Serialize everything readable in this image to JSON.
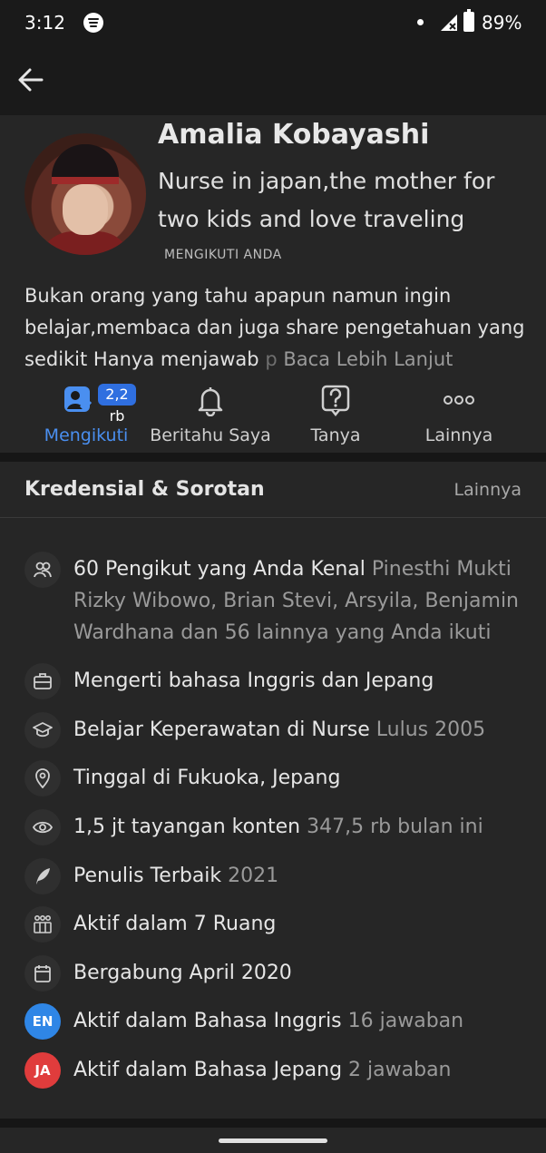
{
  "status_bar": {
    "time": "3:12",
    "battery": "89%"
  },
  "profile": {
    "name": "Amalia Kobayashi",
    "tagline": "Nurse in japan,the mother for two kids and love traveling",
    "follows_you": "MENGIKUTI ANDA",
    "bio_main": "Bukan orang yang tahu apapun namun ingin belajar,membaca dan juga share pengetahuan yang sedikit Hanya menjawab",
    "bio_fade": " p",
    "bio_more": "Baca Lebih Lanjut"
  },
  "actions": {
    "following": {
      "label": "Mengikuti",
      "badge": "2,2 rb"
    },
    "notify": {
      "label": "Beritahu Saya"
    },
    "ask": {
      "label": "Tanya"
    },
    "more": {
      "label": "Lainnya"
    }
  },
  "credentials": {
    "title": "Kredensial & Sorotan",
    "more": "Lainnya",
    "items": [
      {
        "icon": "people-icon",
        "text": "60 Pengikut yang Anda Kenal",
        "sub": "Pinesthi Mukti Rizky Wibowo, Brian Stevi, Arsyila, Benjamin Wardhana dan 56 lainnya yang Anda ikuti"
      },
      {
        "icon": "briefcase-icon",
        "text": "Mengerti bahasa Inggris dan Jepang",
        "sub": ""
      },
      {
        "icon": "graduation-cap-icon",
        "text": "Belajar Keperawatan di Nurse",
        "sub": "Lulus 2005"
      },
      {
        "icon": "location-pin-icon",
        "text": "Tinggal di Fukuoka, Jepang",
        "sub": ""
      },
      {
        "icon": "eye-icon",
        "text": "1,5 jt tayangan konten",
        "sub": "347,5 rb bulan ini"
      },
      {
        "icon": "quill-icon",
        "text": "Penulis Terbaik",
        "sub": "2021"
      },
      {
        "icon": "spaces-icon",
        "text": "Aktif dalam 7 Ruang",
        "sub": ""
      },
      {
        "icon": "calendar-icon",
        "text": "Bergabung April 2020",
        "sub": ""
      },
      {
        "icon": "EN",
        "text": "Aktif dalam Bahasa Inggris",
        "sub": "16 jawaban",
        "color": "#2f86e6"
      },
      {
        "icon": "JA",
        "text": "Aktif dalam Bahasa Jepang",
        "sub": "2 jawaban",
        "color": "#e03c3c"
      }
    ]
  }
}
